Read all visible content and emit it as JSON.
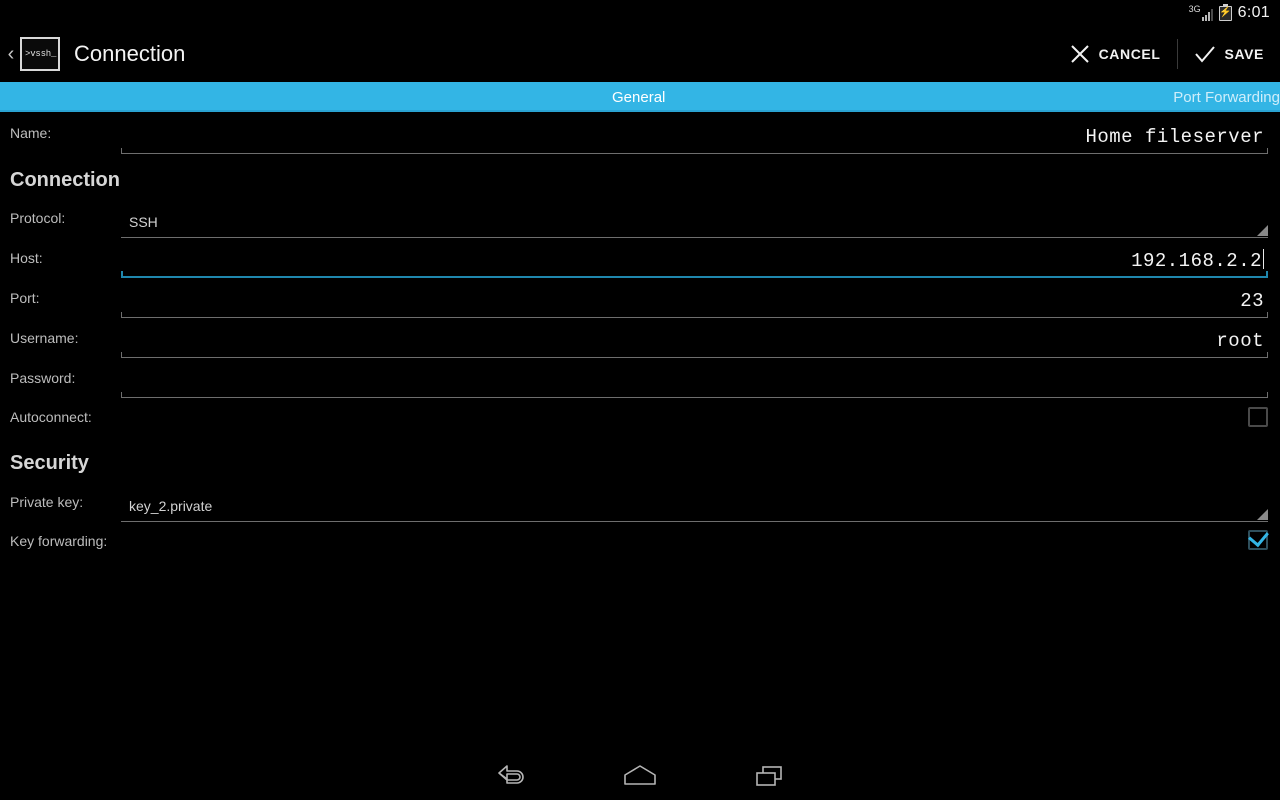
{
  "statusbar": {
    "network_label": "3G",
    "battery_glyph": "⚡",
    "clock": "6:01"
  },
  "actionbar": {
    "up_glyph": "‹",
    "app_icon_text": ">vssh_",
    "title": "Connection",
    "cancel_label": "CANCEL",
    "save_label": "SAVE"
  },
  "tabs": [
    {
      "label": "General",
      "active": true
    },
    {
      "label": "Port Forwarding",
      "active": false
    }
  ],
  "form": {
    "name": {
      "label": "Name:",
      "value": "Home fileserver"
    },
    "section_connection": "Connection",
    "protocol": {
      "label": "Protocol:",
      "value": "SSH"
    },
    "host": {
      "label": "Host:",
      "value": "192.168.2.2"
    },
    "port": {
      "label": "Port:",
      "value": "23"
    },
    "username": {
      "label": "Username:",
      "value": "root"
    },
    "password": {
      "label": "Password:",
      "value": ""
    },
    "autoconnect": {
      "label": "Autoconnect:",
      "checked": false
    },
    "section_security": "Security",
    "private_key": {
      "label": "Private key:",
      "value": "key_2.private"
    },
    "key_forwarding": {
      "label": "Key forwarding:",
      "checked": true
    }
  },
  "navbar": {
    "back": "back-icon",
    "home": "home-icon",
    "recents": "recents-icon"
  },
  "colors": {
    "accent": "#33b5e5",
    "focus_underline": "#1f87ad",
    "background": "#000000",
    "label_text": "#bdbdbd"
  }
}
